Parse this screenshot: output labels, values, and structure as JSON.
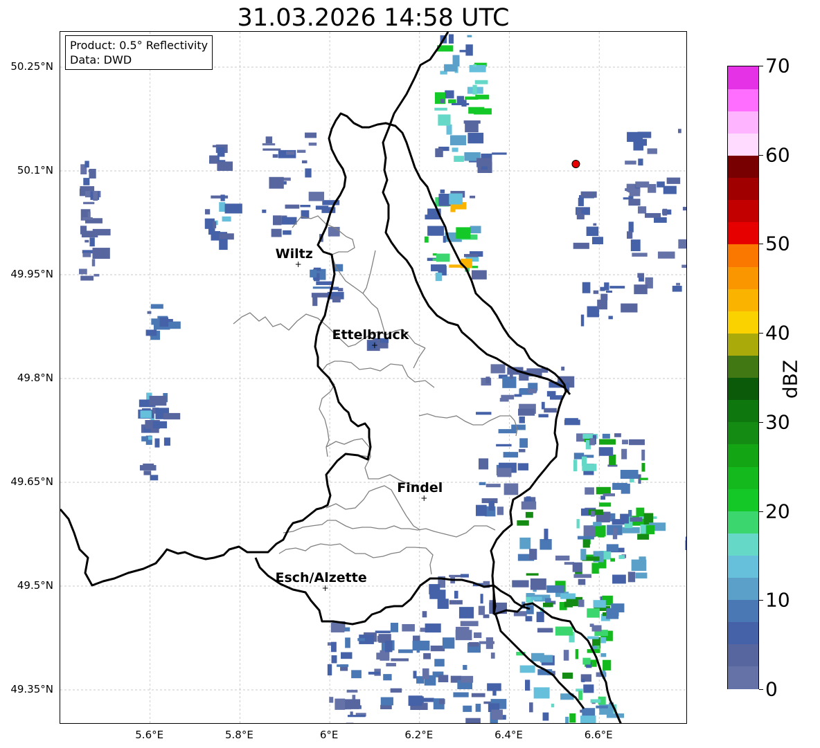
{
  "title": "31.03.2026 14:58 UTC",
  "info": {
    "product": "Product: 0.5° Reflectivity",
    "data": "Data: DWD"
  },
  "lat_ticks": [
    "50.25°N",
    "50.1°N",
    "49.95°N",
    "49.8°N",
    "49.65°N",
    "49.5°N",
    "49.35°N"
  ],
  "lon_ticks": [
    "5.6°E",
    "5.8°E",
    "6°E",
    "6.2°E",
    "6.4°E",
    "6.6°E"
  ],
  "colorbar": {
    "label": "dBZ",
    "ticks": [
      "0",
      "10",
      "20",
      "30",
      "40",
      "50",
      "60",
      "70"
    ],
    "colors": [
      "#6472a8",
      "#57669f",
      "#4562a8",
      "#4a78b4",
      "#5aa0c8",
      "#66c0dc",
      "#66d8c8",
      "#3cd66e",
      "#14c828",
      "#14b91e",
      "#14a514",
      "#148c14",
      "#0e780e",
      "#0a5a0a",
      "#427814",
      "#aaaa0a",
      "#fad200",
      "#fab400",
      "#fa9600",
      "#fa7800",
      "#e60000",
      "#c30000",
      "#a00000",
      "#780000",
      "#ffdcff",
      "#ffb4ff",
      "#ff6eff",
      "#e632e6"
    ]
  },
  "cities": [
    {
      "name": "Wiltz",
      "lon": 5.93,
      "lat": 49.965
    },
    {
      "name": "Ettelbruck",
      "lon": 6.1,
      "lat": 49.848
    },
    {
      "name": "Findel",
      "lon": 6.21,
      "lat": 49.627
    },
    {
      "name": "Esch/Alzette",
      "lon": 5.99,
      "lat": 49.497
    }
  ],
  "radar_site": {
    "lon": 6.548,
    "lat": 50.11,
    "color": "#e60000"
  },
  "colors": {
    "border": "#000000",
    "district": "#808080",
    "grid": "#b8b8b8"
  }
}
